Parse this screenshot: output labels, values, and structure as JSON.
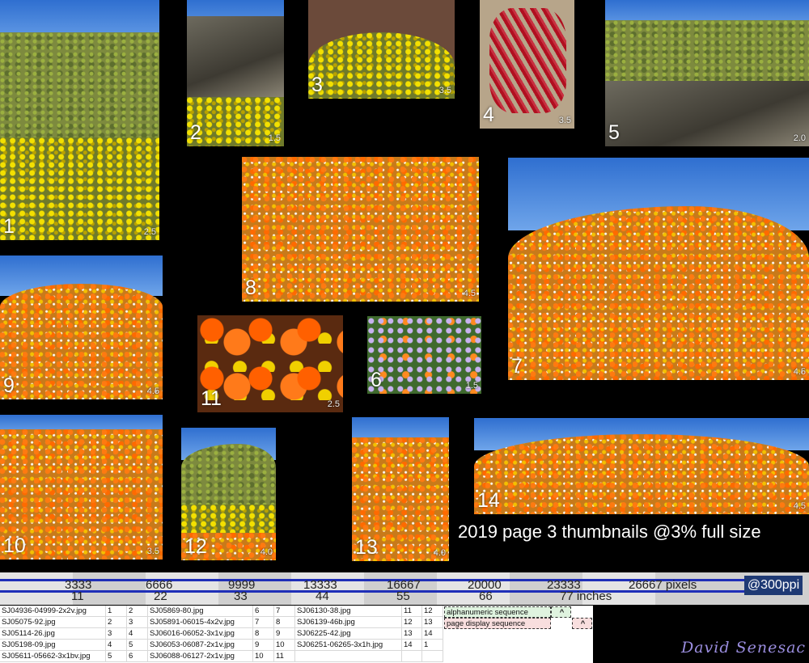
{
  "title": "2019 page 3 thumbnails @3% full size",
  "signature": "David Senesac",
  "ppi_label": "@300ppi",
  "thumbnails": [
    {
      "num": "1",
      "scale": "2.5",
      "subject": "yellow-purple-hillside"
    },
    {
      "num": "2",
      "scale": "1.5",
      "subject": "desert-rock-slope"
    },
    {
      "num": "3",
      "scale": "3.5",
      "subject": "yellow-shrub"
    },
    {
      "num": "4",
      "scale": "3.5",
      "subject": "red-pods"
    },
    {
      "num": "5",
      "scale": "2.0",
      "subject": "desert-wash"
    },
    {
      "num": "6",
      "scale": "1.5",
      "subject": "purple-flowers"
    },
    {
      "num": "7",
      "scale": "4.5",
      "subject": "poppy-hill-wide"
    },
    {
      "num": "8",
      "scale": "4.5",
      "subject": "poppy-field"
    },
    {
      "num": "9",
      "scale": "4.5",
      "subject": "poppy-hill"
    },
    {
      "num": "10",
      "scale": "3.5",
      "subject": "poppies-rocks"
    },
    {
      "num": "11",
      "scale": "2.5",
      "subject": "poppy-closeup"
    },
    {
      "num": "12",
      "scale": "4.0",
      "subject": "poppy-valley"
    },
    {
      "num": "13",
      "scale": "4.0",
      "subject": "poppy-slope"
    },
    {
      "num": "14",
      "scale": "4.5",
      "subject": "poppy-hill-panorama"
    }
  ],
  "ruler": {
    "pixels": [
      "3333",
      "6666",
      "9999",
      "13333",
      "16667",
      "20000",
      "23333",
      "26667 pixels"
    ],
    "inches": [
      "11",
      "22",
      "33",
      "44",
      "55",
      "66",
      "77 inches"
    ]
  },
  "sheet": {
    "rows": [
      [
        "SJ04936-04999-2x2v.jpg",
        "1",
        "2",
        "SJ05869-80.jpg",
        "6",
        "7",
        "SJ06130-38.jpg",
        "11",
        "12"
      ],
      [
        "SJ05075-92.jpg",
        "2",
        "3",
        "SJ05891-06015-4x2v.jpg",
        "7",
        "8",
        "SJ06139-46b.jpg",
        "12",
        "13"
      ],
      [
        "SJ05114-26.jpg",
        "3",
        "4",
        "SJ06016-06052-3x1v.jpg",
        "8",
        "9",
        "SJ06225-42.jpg",
        "13",
        "14"
      ],
      [
        "SJ05198-09.jpg",
        "4",
        "5",
        "SJ06053-06087-2x1v.jpg",
        "9",
        "10",
        "SJ06251-06265-3x1h.jpg",
        "14",
        "1"
      ],
      [
        "SJ05611-05662-3x1bv.jpg",
        "5",
        "6",
        "SJ06088-06127-2x1v.jpg",
        "10",
        "11",
        "",
        "",
        ""
      ]
    ],
    "legend": [
      {
        "label": "alphanumeric sequence",
        "mark": "^"
      },
      {
        "label": "page display sequence",
        "mark": "^"
      }
    ]
  },
  "colors": {
    "ruler_line": "#1f2fb8",
    "ppi_badge": "#1f3a74",
    "signature": "#9b8ee0"
  }
}
